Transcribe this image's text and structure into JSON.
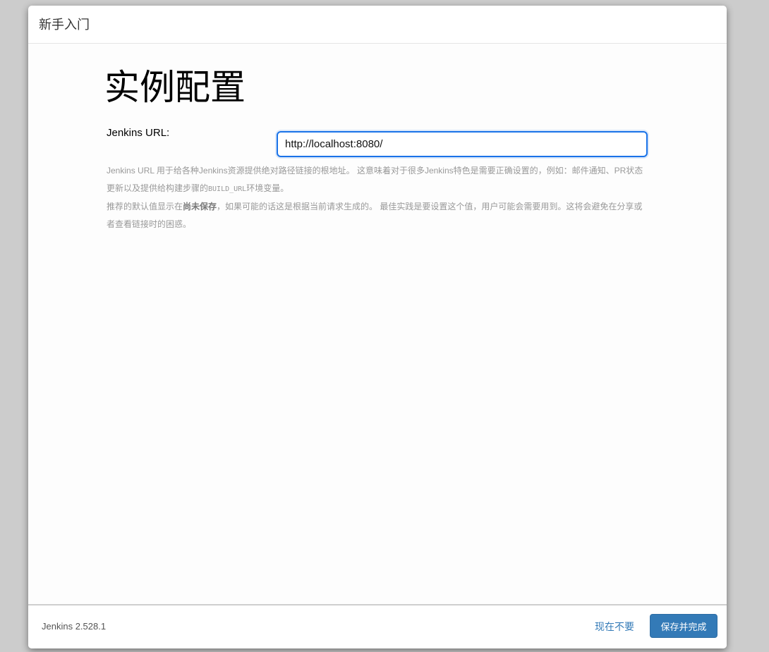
{
  "header": {
    "title": "新手入门"
  },
  "main": {
    "page_title": "实例配置",
    "url_label": "Jenkins URL:",
    "url_value": "http://localhost:8080/",
    "help": {
      "p1_a": "Jenkins URL 用于给各种Jenkins资源提供绝对路径链接的根地址。 这意味着对于很多Jenkins特色是需要正确设置的，例如：邮件通知、PR状态更新以及提供给构建步骤的",
      "p1_code": "BUILD_URL",
      "p1_b": "环境变量。",
      "p2_a": "推荐的默认值显示在",
      "p2_bold": "尚未保存",
      "p2_b": "，如果可能的话这是根据当前请求生成的。 最佳实践是要设置这个值，用户可能会需要用到。这将会避免在分享或者查看链接时的困惑。"
    }
  },
  "footer": {
    "version": "Jenkins 2.528.1",
    "skip_label": "现在不要",
    "save_label": "保存并完成"
  },
  "colors": {
    "primary": "#337ab7",
    "input_focus": "#1a73e8",
    "help_text": "#999999"
  }
}
